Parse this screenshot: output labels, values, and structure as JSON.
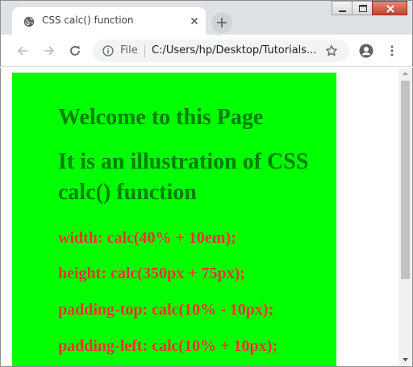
{
  "window": {
    "controls": [
      "minimize",
      "restore",
      "close"
    ]
  },
  "tab": {
    "title": "CSS calc() function",
    "favicon": "globe-icon"
  },
  "toolbar": {
    "scheme_label": "File",
    "url": "C:/Users/hp/Desktop/Tutorials..."
  },
  "page": {
    "background": "#00ff00",
    "heading1": "Welcome to this Page",
    "heading2": "It is an illustration of CSS calc() function",
    "rules": [
      "width: calc(40% + 10em);",
      "height: calc(350px + 75px);",
      "padding-top: calc(10% - 10px);",
      "padding-left: calc(10% + 10px);"
    ],
    "heading_color": "#008000",
    "rule_color": "#ff3030"
  }
}
